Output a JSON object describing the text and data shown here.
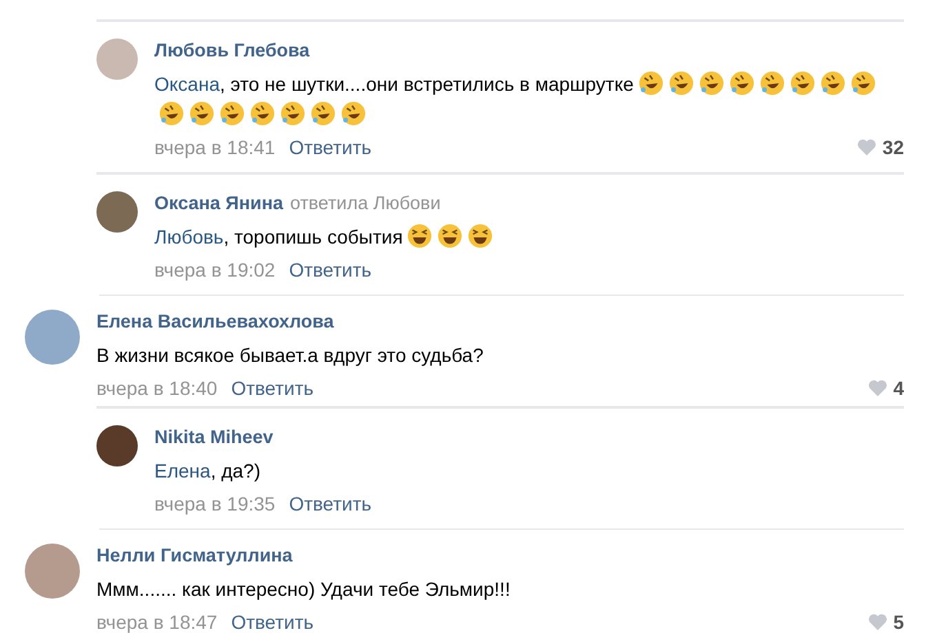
{
  "comments": [
    {
      "kind": "reply",
      "author": "Любовь Глебова",
      "mention": "Оксана",
      "text": ", это не шутки....они встретились в маршрутке",
      "emojis": [
        {
          "kind": "rofl"
        },
        {
          "kind": "rofl"
        },
        {
          "kind": "rofl"
        },
        {
          "kind": "rofl"
        },
        {
          "kind": "rofl"
        },
        {
          "kind": "rofl"
        },
        {
          "kind": "rofl"
        },
        {
          "kind": "rofl"
        },
        {
          "kind": "rofl"
        },
        {
          "kind": "rofl"
        },
        {
          "kind": "rofl"
        },
        {
          "kind": "rofl"
        },
        {
          "kind": "rofl"
        },
        {
          "kind": "rofl"
        },
        {
          "kind": "rofl"
        }
      ],
      "date": "вчера в 18:41",
      "reply_link": "Ответить",
      "likes": "32"
    },
    {
      "kind": "reply",
      "author": "Оксана Янина",
      "replied_to": "ответила Любови",
      "mention": "Любовь",
      "text": ", торопишь события",
      "emojis": [
        {
          "kind": "laugh"
        },
        {
          "kind": "laugh"
        },
        {
          "kind": "laugh"
        }
      ],
      "date": "вчера в 19:02",
      "reply_link": "Ответить"
    },
    {
      "kind": "top",
      "author": "Елена Васильевахохлова",
      "text": "В жизни всякое бывает.а вдруг это судьба?",
      "date": "вчера в 18:40",
      "reply_link": "Ответить",
      "likes": "4"
    },
    {
      "kind": "reply",
      "author": "Nikita Miheev",
      "mention": "Елена",
      "text": ", да?)",
      "date": "вчера в 19:35",
      "reply_link": "Ответить"
    },
    {
      "kind": "top",
      "author": "Нелли Гисматуллина",
      "text": "Ммм....... как интересно) Удачи тебе Эльмир!!!",
      "date": "вчера в 18:47",
      "reply_link": "Ответить",
      "likes": "5"
    }
  ]
}
